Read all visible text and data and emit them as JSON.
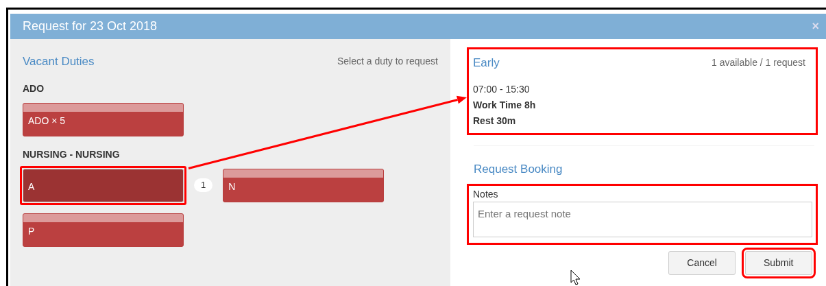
{
  "dialog": {
    "title": "Request for 23 Oct 2018",
    "close": "×"
  },
  "vacant": {
    "title": "Vacant Duties",
    "hint": "Select a duty to request",
    "groups": [
      {
        "name": "ADO",
        "duties": [
          {
            "label": "ADO × 5",
            "selected": false,
            "highlighted": false
          }
        ]
      },
      {
        "name": "NURSING - NURSING",
        "duties": [
          {
            "label": "A",
            "selected": true,
            "highlighted": true,
            "count": "1"
          },
          {
            "label": "N",
            "selected": false,
            "highlighted": false
          },
          {
            "label": "P",
            "selected": false,
            "highlighted": false
          }
        ]
      }
    ]
  },
  "details": {
    "name": "Early",
    "availability": "1 available / 1 request",
    "highlighted": true,
    "lines": [
      {
        "text": "07:00 - 15:30",
        "bold": false
      },
      {
        "text": "Work Time 8h",
        "bold": true
      },
      {
        "text": "Rest 30m",
        "bold": true
      }
    ]
  },
  "booking": {
    "title": "Request Booking",
    "notes_label": "Notes",
    "placeholder": "Enter a request note",
    "notes_highlighted": true
  },
  "buttons": [
    {
      "label": "Cancel",
      "highlighted": false
    },
    {
      "label": "Submit",
      "highlighted": true
    }
  ]
}
